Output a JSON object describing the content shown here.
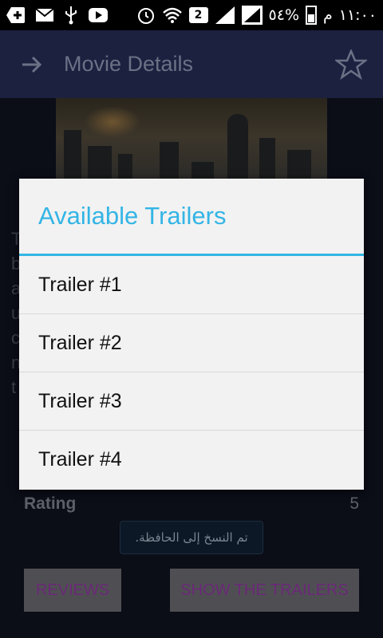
{
  "status_bar": {
    "time": "١١:٠٠",
    "am_pm": "م",
    "battery": "٥٤%",
    "sim_badge": "2",
    "icons": [
      "add-icon",
      "mail-icon",
      "usb-icon",
      "youtube-icon",
      "alarm-icon",
      "wifi-icon",
      "sim-2-icon",
      "signal-icon",
      "signal-icon",
      "battery-icon"
    ]
  },
  "app_bar": {
    "title": "Movie Details",
    "back_icon": "arrow-icon",
    "favorite_icon": "star-icon"
  },
  "details": {
    "rating_label": "Rating",
    "rating_value": "5",
    "description_partial": "T\nb\na\nu\nc\nn\nt"
  },
  "toast": {
    "text": "تم النسخ إلى الحافظة."
  },
  "buttons": {
    "reviews": "REVIEWS",
    "show_trailers": "SHOW THE TRAILERS"
  },
  "dialog": {
    "title": "Available Trailers",
    "items": [
      "Trailer #1",
      "Trailer #2",
      "Trailer #3",
      "Trailer #4"
    ]
  },
  "colors": {
    "accent": "#33b5e5",
    "app_bar": "#1c2140",
    "button_text": "#6b2878"
  }
}
